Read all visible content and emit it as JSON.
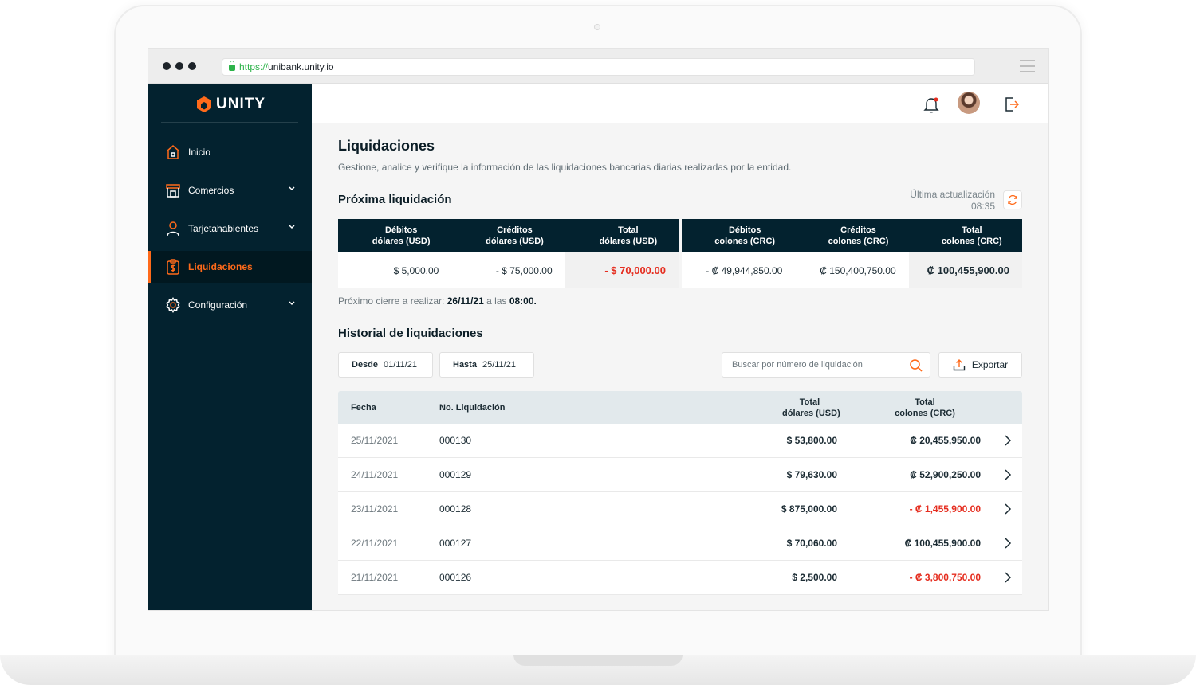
{
  "browser": {
    "url_protocol": "https://",
    "url_host": "unibank.unity.io"
  },
  "brand": {
    "name": "UNITY",
    "accent_color": "#ff6a1a",
    "sidebar_color": "#03222f"
  },
  "sidebar": {
    "items": [
      {
        "label": "Inicio",
        "icon": "home-icon"
      },
      {
        "label": "Comercios",
        "icon": "store-icon",
        "has_submenu": true
      },
      {
        "label": "Tarjetahabientes",
        "icon": "user-icon",
        "has_submenu": true
      },
      {
        "label": "Liquidaciones",
        "icon": "invoice-icon",
        "active": true
      },
      {
        "label": "Configuración",
        "icon": "gear-icon",
        "has_submenu": true
      }
    ]
  },
  "page": {
    "title": "Liquidaciones",
    "subtitle": "Gestione, analice y verifique la información de las liquidaciones bancarias diarias realizadas por la entidad."
  },
  "next": {
    "title": "Próxima liquidación",
    "update_label": "Última actualización",
    "update_time": "08:35",
    "usd_headers": [
      {
        "line1": "Débitos",
        "line2": "dólares (USD)"
      },
      {
        "line1": "Créditos",
        "line2": "dólares (USD)"
      },
      {
        "line1": "Total",
        "line2": "dólares (USD)"
      }
    ],
    "crc_headers": [
      {
        "line1": "Débitos",
        "line2": "colones (CRC)"
      },
      {
        "line1": "Créditos",
        "line2": "colones (CRC)"
      },
      {
        "line1": "Total",
        "line2": "colones (CRC)"
      }
    ],
    "usd_values": {
      "debits": "$ 5,000.00",
      "credits": "- $ 75,000.00",
      "total": "- $ 70,000.00"
    },
    "crc_values": {
      "debits": "- ₡ 49,944,850.00",
      "credits": "₡ 150,400,750.00",
      "total": "₡ 100,455,900.00"
    },
    "close_prefix": "Próximo cierre a realizar:",
    "close_date": "26/11/21",
    "close_mid": "a las",
    "close_time": "08:00."
  },
  "history": {
    "title": "Historial de liquidaciones",
    "from_label": "Desde",
    "from_value": "01/11/21",
    "to_label": "Hasta",
    "to_value": "25/11/21",
    "search_placeholder": "Buscar por número de liquidación",
    "export_label": "Exportar",
    "columns": {
      "date": "Fecha",
      "number": "No. Liquidación",
      "usd_line1": "Total",
      "usd_line2": "dólares (USD)",
      "crc_line1": "Total",
      "crc_line2": "colones (CRC)"
    },
    "rows": [
      {
        "date": "25/11/2021",
        "number": "000130",
        "usd": "$ 53,800.00",
        "crc": "₡ 20,455,950.00",
        "crc_negative": false
      },
      {
        "date": "24/11/2021",
        "number": "000129",
        "usd": "$ 79,630.00",
        "crc": "₡ 52,900,250.00",
        "crc_negative": false
      },
      {
        "date": "23/11/2021",
        "number": "000128",
        "usd": "$ 875,000.00",
        "crc": "- ₡ 1,455,900.00",
        "crc_negative": true
      },
      {
        "date": "22/11/2021",
        "number": "000127",
        "usd": "$ 70,060.00",
        "crc": "₡ 100,455,900.00",
        "crc_negative": false
      },
      {
        "date": "21/11/2021",
        "number": "000126",
        "usd": "$ 2,500.00",
        "crc": "- ₡ 3,800,750.00",
        "crc_negative": true
      }
    ]
  }
}
